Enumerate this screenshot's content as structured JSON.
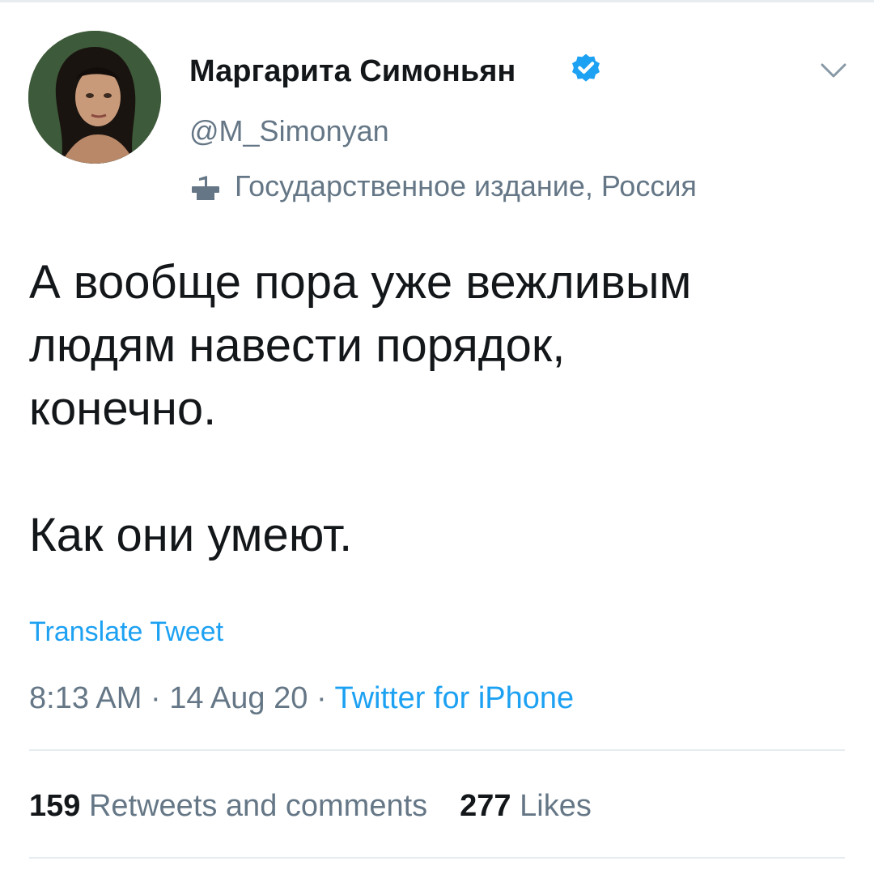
{
  "author": {
    "name": "Маргарита Симоньян",
    "handle": "@M_Simonyan",
    "label": "Государственное издание, Россия",
    "verified": true
  },
  "tweet": {
    "lines": [
      "А вообще пора уже вежливым",
      "людям навести порядок,",
      "конечно.",
      "Как они умеют."
    ],
    "translate_label": "Translate Tweet",
    "time": "8:13 AM",
    "date": "14 Aug 20",
    "separator": "·",
    "source": "Twitter for iPhone"
  },
  "stats": {
    "retweets_count": "159",
    "retweets_label": "Retweets and comments",
    "likes_count": "277",
    "likes_label": "Likes"
  },
  "colors": {
    "text": "#14171a",
    "secondary": "#657786",
    "accent": "#1da1f2",
    "divider": "#e6ecf0"
  },
  "icons": {
    "verified": "verified-badge-icon",
    "menu": "chevron-down-icon",
    "label": "podium-icon"
  }
}
